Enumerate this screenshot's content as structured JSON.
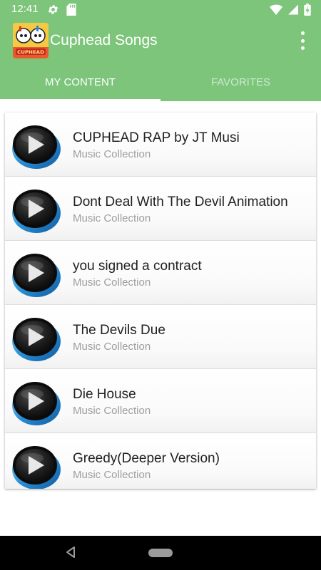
{
  "status_bar": {
    "time": "12:41",
    "icons": [
      "settings-gear-icon",
      "sd-card-icon",
      "wifi-icon",
      "signal-icon",
      "battery-charging-icon"
    ]
  },
  "app_bar": {
    "title": "Cuphead Songs",
    "logo_text": "CUPHEAD",
    "menu_icon": "overflow-menu-icon"
  },
  "tabs": [
    {
      "label": "MY CONTENT",
      "active": true
    },
    {
      "label": "FAVORITES",
      "active": false
    }
  ],
  "songs": [
    {
      "title": "CUPHEAD RAP by JT Musi",
      "subtitle": "Music Collection"
    },
    {
      "title": "Dont Deal With The Devil Animation",
      "subtitle": "Music Collection"
    },
    {
      "title": "you signed a contract",
      "subtitle": "Music Collection"
    },
    {
      "title": "The Devils Due",
      "subtitle": "Music Collection"
    },
    {
      "title": "Die House",
      "subtitle": "Music Collection"
    },
    {
      "title": "Greedy(Deeper Version)",
      "subtitle": "Music Collection"
    }
  ],
  "nav_bar": {
    "icons": [
      "back-icon",
      "home-icon"
    ]
  },
  "colors": {
    "primary": "#7cc57a",
    "text_primary": "#212121",
    "text_secondary": "#9e9e9e"
  }
}
